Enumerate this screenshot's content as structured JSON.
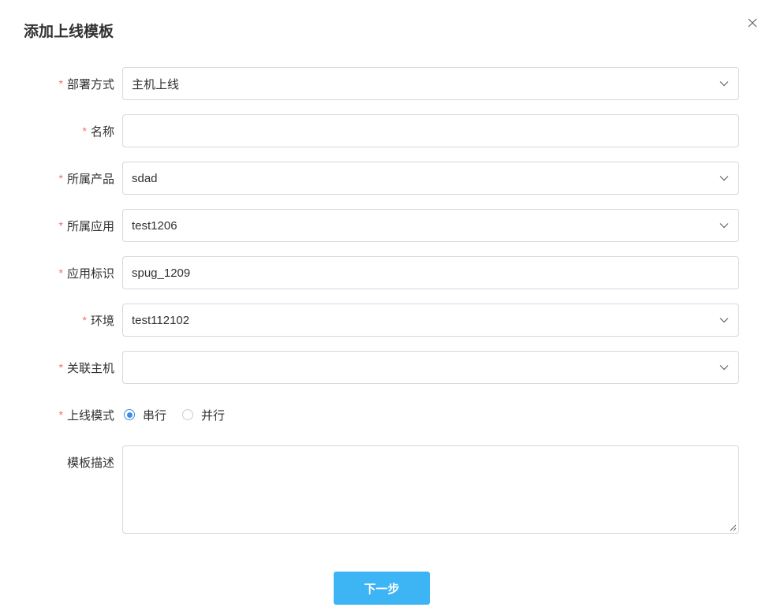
{
  "dialog": {
    "title": "添加上线模板",
    "close_icon": "close-icon"
  },
  "form": {
    "deploy_method": {
      "label": "部署方式",
      "required": true,
      "value": "主机上线"
    },
    "name": {
      "label": "名称",
      "required": true,
      "value": ""
    },
    "product": {
      "label": "所属产品",
      "required": true,
      "value": "sdad"
    },
    "application": {
      "label": "所属应用",
      "required": true,
      "value": "test1206"
    },
    "app_identifier": {
      "label": "应用标识",
      "required": true,
      "value": "spug_1209"
    },
    "environment": {
      "label": "环境",
      "required": true,
      "value": "test112102"
    },
    "hosts": {
      "label": "关联主机",
      "required": true,
      "value": ""
    },
    "deploy_mode": {
      "label": "上线模式",
      "required": true,
      "options": [
        "串行",
        "并行"
      ],
      "selected": "串行"
    },
    "description": {
      "label": "模板描述",
      "required": false,
      "value": ""
    }
  },
  "footer": {
    "next_label": "下一步"
  },
  "colors": {
    "primary": "#3db5f5",
    "radio_checked": "#3f8ae8",
    "required_star": "#f56c6c",
    "border": "#d4d7e0"
  }
}
